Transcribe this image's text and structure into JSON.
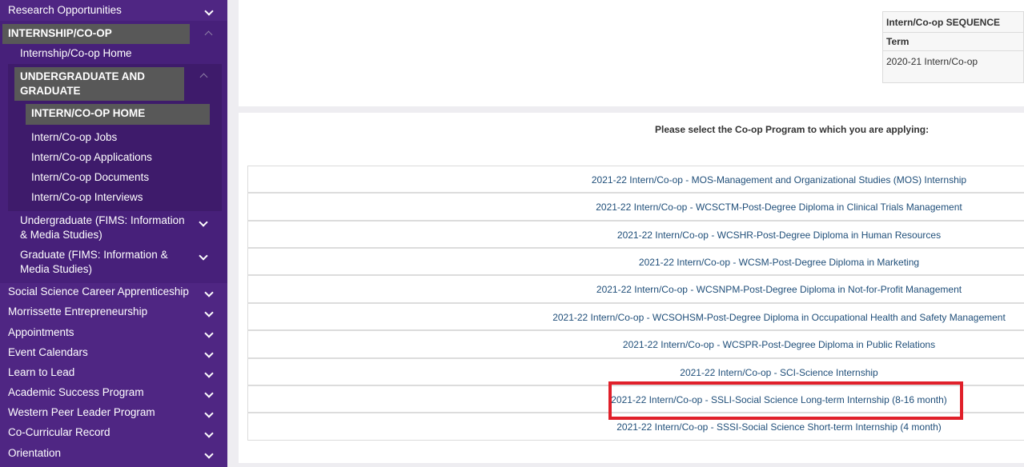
{
  "sidebar": {
    "research": "Research Opportunities",
    "internship_head": "INTERNSHIP/CO-OP",
    "internship_home": "Internship/Co-op Home",
    "ug_grad_head": "UNDERGRADUATE AND GRADUATE",
    "intern_home": "INTERN/CO-OP HOME",
    "intern_jobs": "Intern/Co-op Jobs",
    "intern_apps": "Intern/Co-op Applications",
    "intern_docs": "Intern/Co-op Documents",
    "intern_interviews": "Intern/Co-op Interviews",
    "ug_fims": "Undergraduate (FIMS: Information & Media Studies)",
    "grad_fims": "Graduate (FIMS: Information & Media Studies)",
    "items": [
      "Social Science Career Apprenticeship",
      "Morrissette Entrepreneurship",
      "Appointments",
      "Event Calendars",
      "Learn to Lead",
      "Academic Success Program",
      "Western Peer Leader Program",
      "Co-Curricular Record",
      "Orientation"
    ]
  },
  "sequence": {
    "header": "Intern/Co-op SEQUENCE",
    "term_label": "Term",
    "term_value": "2020-21 Intern/Co-op"
  },
  "prompt": "Please select the Co-op Program to which you are applying:",
  "programs": [
    "2021-22 Intern/Co-op - MOS-Management and Organizational Studies (MOS) Internship",
    "2021-22 Intern/Co-op - WCSCTM-Post-Degree Diploma in Clinical Trials Management",
    "2021-22 Intern/Co-op - WCSHR-Post-Degree Diploma in Human Resources",
    "2021-22 Intern/Co-op - WCSM-Post-Degree Diploma in Marketing",
    "2021-22 Intern/Co-op - WCSNPM-Post-Degree Diploma in Not-for-Profit Management",
    "2021-22 Intern/Co-op - WCSOHSM-Post-Degree Diploma in Occupational Health and Safety Management",
    "2021-22 Intern/Co-op - WCSPR-Post-Degree Diploma in Public Relations",
    "2021-22 Intern/Co-op - SCI-Science Internship",
    "2021-22 Intern/Co-op - SSLI-Social Science Long-term Internship (8-16 month)",
    "2021-22 Intern/Co-op - SSSI-Social Science Short-term Internship (4 month)"
  ],
  "colors": {
    "sidebar_bg": "#4f2683",
    "active_bg": "#585858",
    "link": "#1f4e79",
    "highlight": "#e0202a"
  }
}
